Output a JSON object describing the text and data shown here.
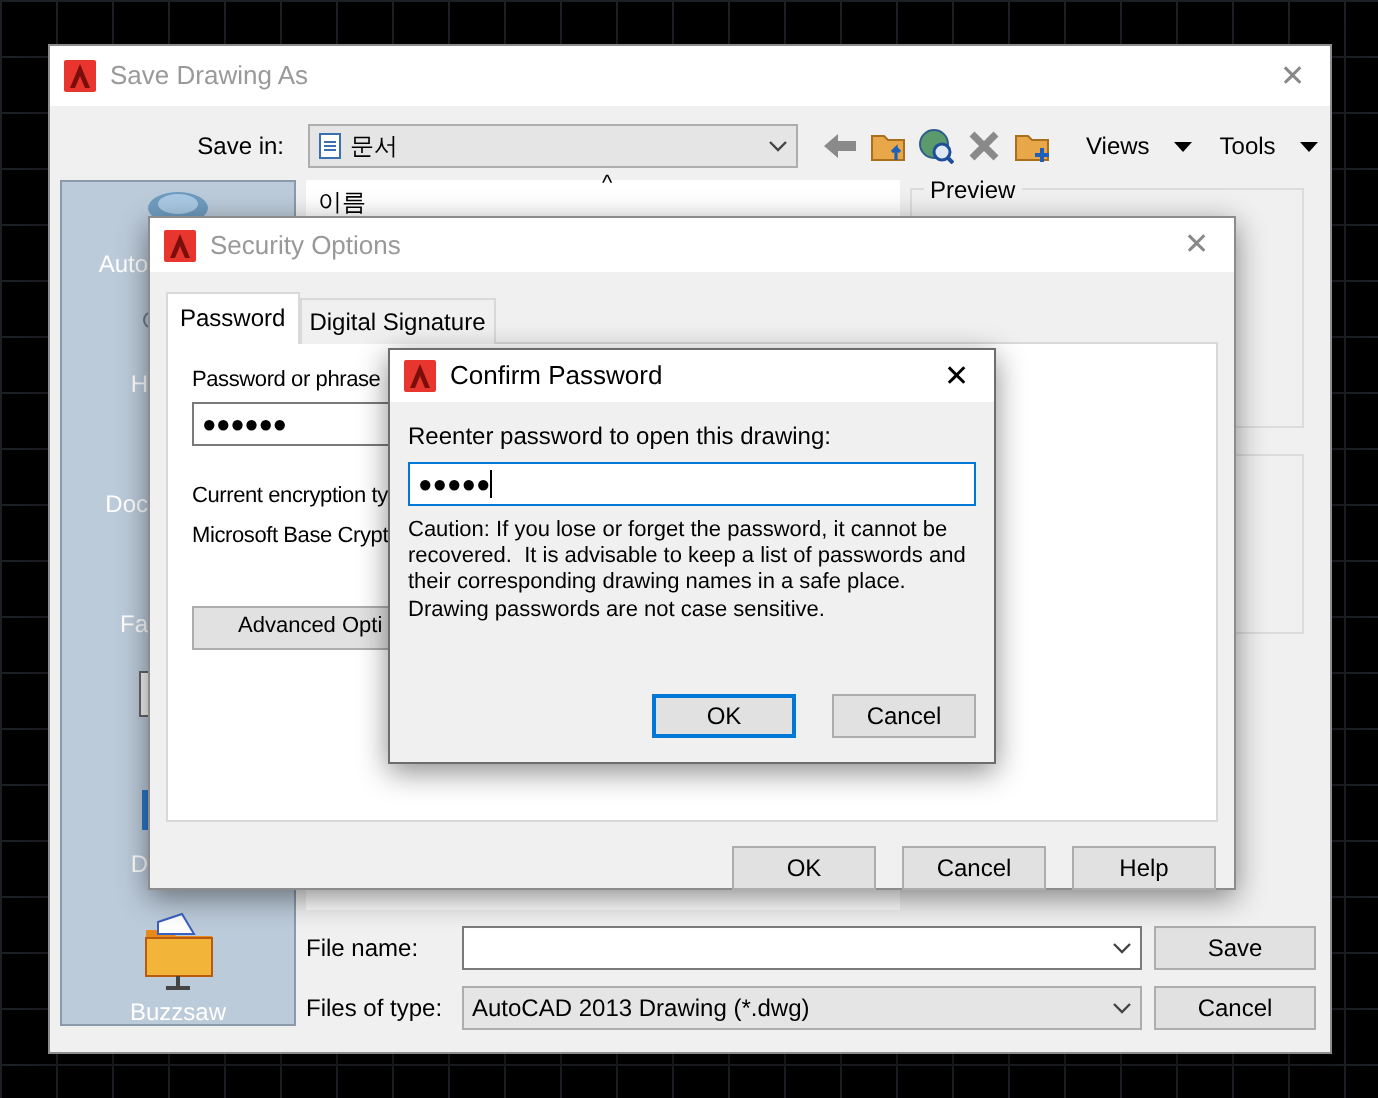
{
  "save_dialog": {
    "title": "Save Drawing As",
    "active": false,
    "close": "✕",
    "save_in": {
      "label": "Save in:",
      "value": "문서"
    },
    "toolbar": {
      "views": "Views",
      "tools": "Tools"
    },
    "places": [
      {
        "label": "Auto",
        "kind": "cut"
      },
      {
        "label": "H",
        "kind": "cut"
      },
      {
        "label": "Doc",
        "kind": "cut"
      },
      {
        "label": "Fa",
        "kind": "cut"
      },
      {
        "kind": "hidden"
      },
      {
        "label": "D",
        "kind": "cut"
      },
      {
        "label": "Buzzsaw",
        "kind": "whole"
      }
    ],
    "file_list": {
      "column": "이름",
      "sort_mark": "^"
    },
    "preview": {
      "label": "Preview"
    },
    "file_name": {
      "label": "File name:"
    },
    "file_type": {
      "label": "Files of type:",
      "value": "AutoCAD 2013 Drawing (*.dwg)"
    },
    "buttons": [
      {
        "label": "Save",
        "default": false
      },
      {
        "label": "Cancel",
        "default": false
      }
    ]
  },
  "security_dialog": {
    "title": "Security Options",
    "active": false,
    "close": "✕",
    "tabs": [
      {
        "label": "Password",
        "selected": true
      },
      {
        "label": "Digital Signature",
        "selected": false
      }
    ],
    "password_label": "Password or phrase",
    "password": {
      "value": "●●●●●●",
      "focused": false
    },
    "encryption_label": "Current encryption ty",
    "encryption_value": "Microsoft Base Crypt",
    "advanced_button": "Advanced Opti",
    "buttons": [
      {
        "label": "OK",
        "default": false
      },
      {
        "label": "Cancel",
        "default": false
      },
      {
        "label": "Help",
        "default": false
      }
    ]
  },
  "confirm_dialog": {
    "title": "Confirm Password",
    "active": true,
    "close": "✕",
    "label": "Reenter password to open this drawing:",
    "password": {
      "value": "●●●●●",
      "focused": true
    },
    "caution": "Caution: If you lose or forget the password, it cannot be recovered.  It is advisable to keep a list of passwords and their corresponding drawing names in a safe place.  Drawing passwords are not case sensitive.",
    "buttons": [
      {
        "label": "OK",
        "default": true
      },
      {
        "label": "Cancel",
        "default": false
      }
    ]
  }
}
